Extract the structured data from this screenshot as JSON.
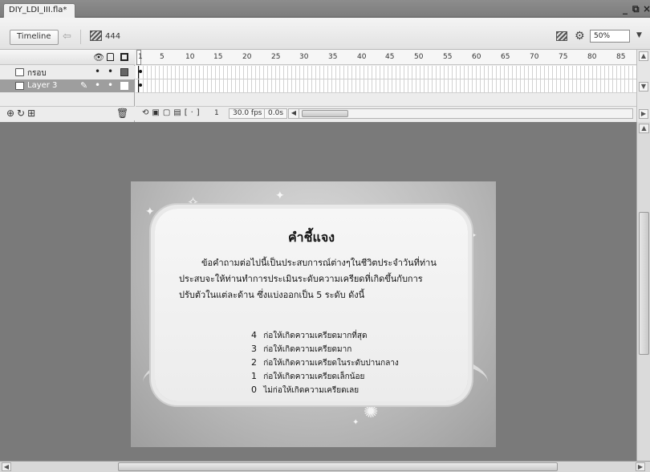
{
  "document_tab": {
    "title": "DIY_LDI_III.fla*"
  },
  "window_controls": {
    "minimize": "_",
    "restore": "⧉",
    "close": "×"
  },
  "toolbar": {
    "timeline_label": "Timeline",
    "scene_label": "444",
    "zoom_value": "50%"
  },
  "timeline": {
    "ruler_numbers": [
      "1",
      "5",
      "10",
      "15",
      "20",
      "25",
      "30",
      "35",
      "40",
      "45",
      "50",
      "55",
      "60",
      "65",
      "70",
      "75",
      "80",
      "85"
    ],
    "layers": [
      {
        "name": "กรอบ",
        "selected": false
      },
      {
        "name": "Layer 3",
        "selected": true
      }
    ],
    "footer": {
      "current_frame": "1",
      "fps": "30.0 fps",
      "time": "0.0s"
    }
  },
  "stage": {
    "title": "คำชี้แจง",
    "paragraph_lines": [
      "ข้อคำถามต่อไปนี้เป็นประสบการณ์ต่างๆในชีวิตประจำวันที่ท่าน",
      "ประสบจะให้ท่านทำการประเมินระดับความเครียดที่เกิดขึ้นกับการ",
      "ปรับตัวในแต่ละด้าน ซึ่งแบ่งออกเป็น 5 ระดับ ดังนี้"
    ],
    "scale_items": [
      {
        "value": "4",
        "label": "ก่อให้เกิดความเครียดมากที่สุด"
      },
      {
        "value": "3",
        "label": "ก่อให้เกิดความเครียดมาก"
      },
      {
        "value": "2",
        "label": "ก่อให้เกิดความเครียดในระดับปานกลาง"
      },
      {
        "value": "1",
        "label": "ก่อให้เกิดความเครียดเล็กน้อย"
      },
      {
        "value": "0",
        "label": "ไม่ก่อให้เกิดความเครียดเลย"
      }
    ]
  }
}
